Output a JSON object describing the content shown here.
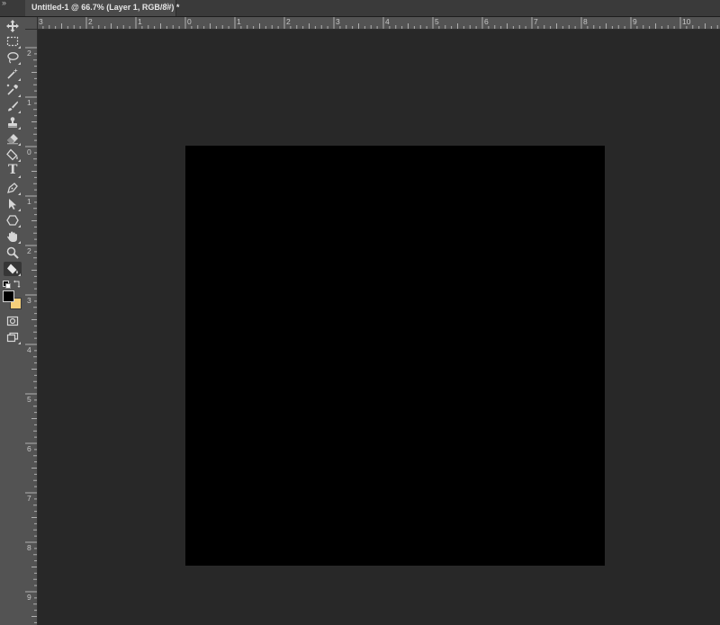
{
  "window": {
    "collapse_glyph": "»",
    "document_tab": {
      "title": "Untitled-1 @ 66.7% (Layer 1, RGB/8#) *",
      "close_glyph": "×"
    }
  },
  "tools": [
    {
      "name": "move-tool",
      "icon": "move-icon"
    },
    {
      "name": "rectangular-marquee-tool",
      "icon": "marquee-icon"
    },
    {
      "name": "lasso-tool",
      "icon": "lasso-icon"
    },
    {
      "name": "magic-wand-tool",
      "icon": "magic-wand-icon"
    },
    {
      "name": "eyedropper-tool",
      "icon": "eyedropper-icon"
    },
    {
      "name": "brush-tool",
      "icon": "brush-icon"
    },
    {
      "name": "clone-stamp-tool",
      "icon": "stamp-icon"
    },
    {
      "name": "eraser-tool",
      "icon": "eraser-icon"
    },
    {
      "name": "paint-bucket-tool",
      "icon": "paint-bucket-icon"
    },
    {
      "name": "type-tool",
      "icon": "type-icon",
      "glyph": "T"
    },
    {
      "name": "pen-tool",
      "icon": "pen-icon"
    },
    {
      "name": "path-selection-tool",
      "icon": "arrow-icon"
    },
    {
      "name": "shape-tool",
      "icon": "hexagon-icon"
    },
    {
      "name": "hand-tool",
      "icon": "hand-icon"
    },
    {
      "name": "zoom-tool",
      "icon": "zoom-icon"
    },
    {
      "name": "fill-tool-active",
      "icon": "paint-bucket-icon",
      "active": true
    }
  ],
  "colors": {
    "foreground": "#000000",
    "background": "#f5cf7a",
    "workspace": "#282828",
    "canvas": "#000000",
    "ui_panel": "#535353"
  },
  "rulers": {
    "horizontal_labels": [
      "3",
      "2",
      "1",
      "0",
      "1",
      "2",
      "3",
      "4",
      "5",
      "6",
      "7",
      "8",
      "9",
      "10"
    ],
    "vertical_labels": [
      "2",
      "1",
      "0",
      "1",
      "2",
      "3",
      "4",
      "5",
      "6",
      "7",
      "8",
      "9"
    ]
  }
}
